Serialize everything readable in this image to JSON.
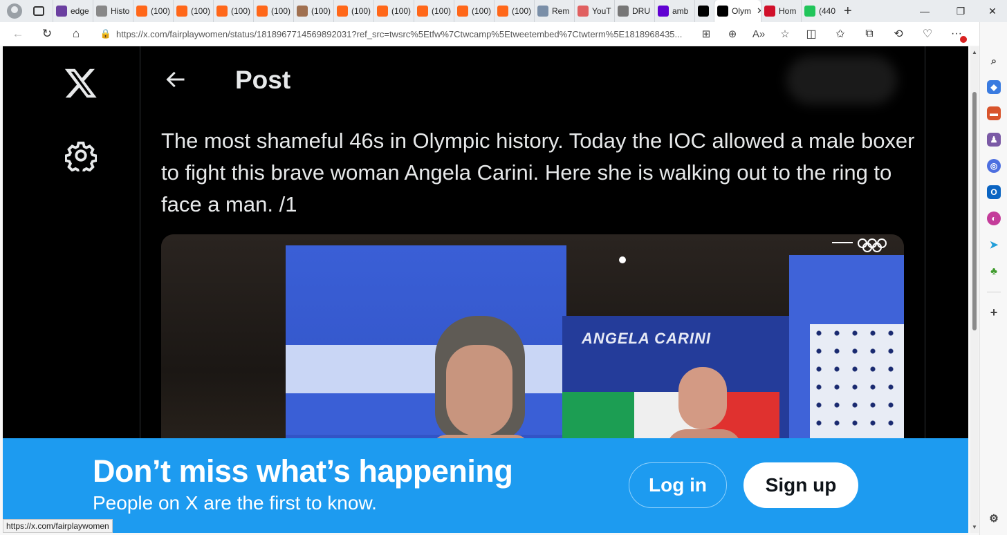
{
  "browser": {
    "tabs": [
      {
        "label": "edge",
        "icon": "yahoo-icon",
        "color": "#6b3fa0"
      },
      {
        "label": "Histo",
        "icon": "history-icon",
        "color": "#888888"
      },
      {
        "label": "(100)",
        "icon": "substack-icon",
        "color": "#ff6719"
      },
      {
        "label": "(100)",
        "icon": "substack-icon",
        "color": "#ff6719"
      },
      {
        "label": "(100)",
        "icon": "substack-icon",
        "color": "#ff6719"
      },
      {
        "label": "(100)",
        "icon": "substack-icon",
        "color": "#ff6719"
      },
      {
        "label": "(100)",
        "icon": "avatar-icon",
        "color": "#a07050"
      },
      {
        "label": "(100)",
        "icon": "substack-icon",
        "color": "#ff6719"
      },
      {
        "label": "(100)",
        "icon": "substack-icon",
        "color": "#ff6719"
      },
      {
        "label": "(100)",
        "icon": "substack-icon",
        "color": "#ff6719"
      },
      {
        "label": "(100)",
        "icon": "substack-icon",
        "color": "#ff6719"
      },
      {
        "label": "(100)",
        "icon": "substack-icon",
        "color": "#ff6719"
      },
      {
        "label": "Rem",
        "icon": "link-icon",
        "color": "#7a8fa8"
      },
      {
        "label": "YouT",
        "icon": "youtube-icon",
        "color": "#e06060"
      },
      {
        "label": "DRU",
        "icon": "drudge-icon",
        "color": "#777777"
      },
      {
        "label": "amb",
        "icon": "yahoo-icon",
        "color": "#6001d2"
      },
      {
        "label": "",
        "icon": "ok-icon",
        "color": "#000000"
      },
      {
        "label": "Olym",
        "icon": "x-icon",
        "color": "#000000"
      },
      {
        "label": "Hom",
        "icon": "truth-icon",
        "color": "#d0102a"
      },
      {
        "label": "(440",
        "icon": "gab-icon",
        "color": "#21c55a"
      }
    ],
    "active_tab_index": 17,
    "url": "https://x.com/fairplaywomen/status/1818967714569892031?ref_src=twsrc%5Etfw%7Ctwcamp%5Etweetembed%7Ctwterm%5E1818968435...",
    "status_link": "https://x.com/fairplaywomen"
  },
  "header": {
    "title": "Post"
  },
  "tweet": {
    "text": "The most shameful 46s in Olympic history. Today the IOC allowed a male boxer to fight this brave woman Angela Carini. Here she is walking out to the ring to face a man. /1",
    "media_caption": "ANGELA CARINI"
  },
  "banner": {
    "title": "Don’t miss what’s happening",
    "subtitle": "People on X are the first to know.",
    "login_label": "Log in",
    "signup_label": "Sign up"
  },
  "colors": {
    "accent": "#1d9bf0",
    "background": "#000000",
    "text": "#e7e9ea"
  }
}
